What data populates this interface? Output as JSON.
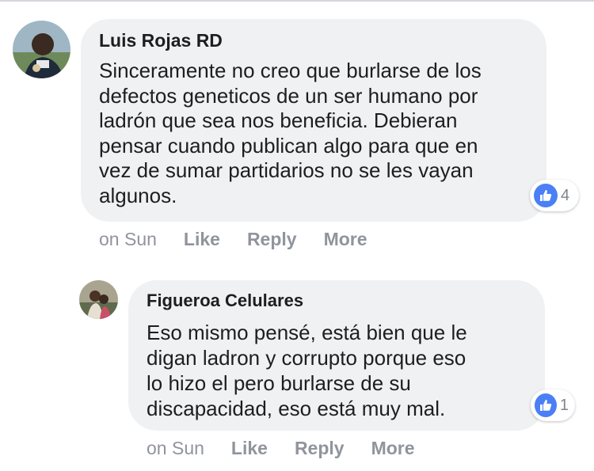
{
  "comments": [
    {
      "author": "Luis Rojas RD",
      "lines": [
        "Sinceramente no creo que burlarse de los",
        "defectos geneticos de un ser humano por",
        "ladrón que sea nos beneficia. Debieran",
        "pensar cuando publican algo para que en",
        "vez de sumar partidarios no se les vayan",
        "algunos."
      ],
      "reaction_count": "4",
      "time": "on Sun",
      "like_label": "Like",
      "reply_label": "Reply",
      "more_label": "More"
    },
    {
      "author": "Figueroa Celulares",
      "lines": [
        "Eso mismo pensé, está bien que le",
        "digan ladron y corrupto porque eso",
        "lo hizo el pero burlarse de su",
        "discapacidad, eso está muy mal."
      ],
      "reaction_count": "1",
      "time": "on Sun",
      "like_label": "Like",
      "reply_label": "Reply",
      "more_label": "More"
    }
  ],
  "colors": {
    "bubble": "#f0f1f3",
    "text": "#1c1e21",
    "meta": "#90949c",
    "like_blue": "#4a7ff5"
  },
  "icons": [
    "like-icon"
  ]
}
